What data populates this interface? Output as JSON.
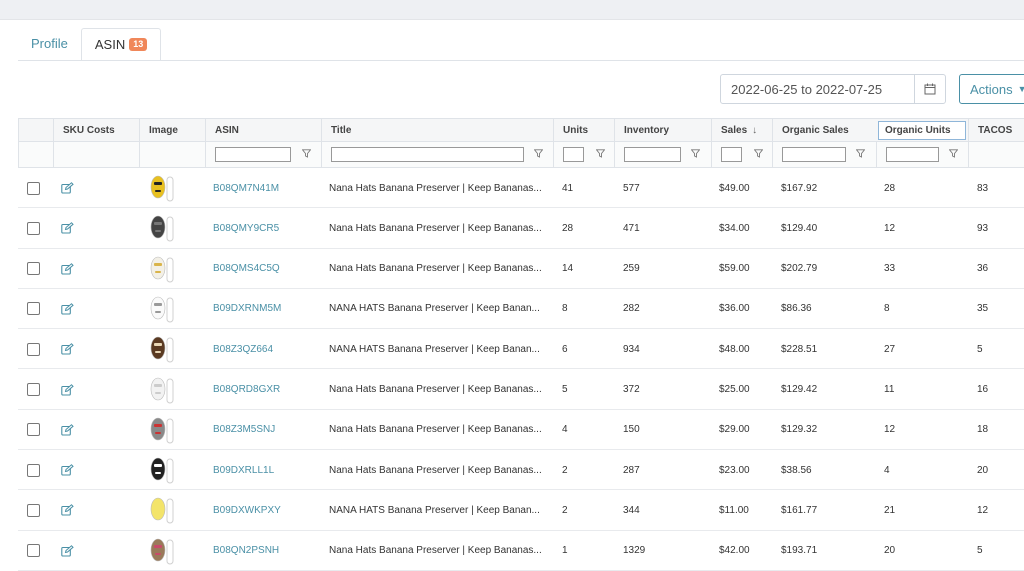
{
  "tabs": [
    {
      "label": "Profile",
      "active": false
    },
    {
      "label": "ASIN",
      "active": true,
      "badge": "13"
    }
  ],
  "date_range": {
    "value": "2022-06-25 to 2022-07-25"
  },
  "actions": {
    "label": "Actions"
  },
  "columns": {
    "sku_costs": "SKU Costs",
    "image": "Image",
    "asin": "ASIN",
    "title": "Title",
    "units": "Units",
    "inventory": "Inventory",
    "sales": "Sales",
    "organic_sales": "Organic Sales",
    "organic_units": "Organic Units",
    "tacos": "TACOS"
  },
  "sort_indicator": "↓",
  "colors": {
    "link": "#4a90a6",
    "badge": "#f0875a",
    "header_bg": "#f5f6f7",
    "border": "#dfe3e8"
  },
  "rows": [
    {
      "asin": "B08QM7N41M",
      "title": "Nana Hats Banana Preserver | Keep Bananas...",
      "units": "41",
      "inventory": "577",
      "sales": "$49.00",
      "organic_sales": "$167.92",
      "organic_units": "28",
      "tacos": "83",
      "hat_color": "#e8c020",
      "hat_accent": "#222"
    },
    {
      "asin": "B08QMY9CR5",
      "title": "Nana Hats Banana Preserver | Keep Bananas...",
      "units": "28",
      "inventory": "471",
      "sales": "$34.00",
      "organic_sales": "$129.40",
      "organic_units": "12",
      "tacos": "93",
      "hat_color": "#444",
      "hat_accent": "#777"
    },
    {
      "asin": "B08QMS4C5Q",
      "title": "Nana Hats Banana Preserver | Keep Bananas...",
      "units": "14",
      "inventory": "259",
      "sales": "$59.00",
      "organic_sales": "$202.79",
      "organic_units": "33",
      "tacos": "36",
      "hat_color": "#f3f0e6",
      "hat_accent": "#d9b44a"
    },
    {
      "asin": "B09DXRNM5M",
      "title": "NANA HATS Banana Preserver | Keep Banan...",
      "units": "8",
      "inventory": "282",
      "sales": "$36.00",
      "organic_sales": "$86.36",
      "organic_units": "8",
      "tacos": "35",
      "hat_color": "#fafafa",
      "hat_accent": "#999"
    },
    {
      "asin": "B08Z3QZ664",
      "title": "NANA HATS Banana Preserver | Keep Banan...",
      "units": "6",
      "inventory": "934",
      "sales": "$48.00",
      "organic_sales": "$228.51",
      "organic_units": "27",
      "tacos": "5",
      "hat_color": "#5a3a22",
      "hat_accent": "#e9d7b6"
    },
    {
      "asin": "B08QRD8GXR",
      "title": "Nana Hats Banana Preserver | Keep Bananas...",
      "units": "5",
      "inventory": "372",
      "sales": "$25.00",
      "organic_sales": "$129.42",
      "organic_units": "11",
      "tacos": "16",
      "hat_color": "#f2f2f2",
      "hat_accent": "#ccc"
    },
    {
      "asin": "B08Z3M5SNJ",
      "title": "Nana Hats Banana Preserver | Keep Bananas...",
      "units": "4",
      "inventory": "150",
      "sales": "$29.00",
      "organic_sales": "$129.32",
      "organic_units": "12",
      "tacos": "18",
      "hat_color": "#8a8a8a",
      "hat_accent": "#c33"
    },
    {
      "asin": "B09DXRLL1L",
      "title": "Nana Hats Banana Preserver | Keep Bananas...",
      "units": "2",
      "inventory": "287",
      "sales": "$23.00",
      "organic_sales": "$38.56",
      "organic_units": "4",
      "tacos": "20",
      "hat_color": "#222",
      "hat_accent": "#fff"
    },
    {
      "asin": "B09DXWKPXY",
      "title": "NANA HATS Banana Preserver | Keep Banan...",
      "units": "2",
      "inventory": "344",
      "sales": "$11.00",
      "organic_sales": "$161.77",
      "organic_units": "21",
      "tacos": "12",
      "hat_color": "#f3e46a",
      "hat_accent": "#f3e46a"
    },
    {
      "asin": "B08QN2PSNH",
      "title": "Nana Hats Banana Preserver | Keep Bananas...",
      "units": "1",
      "inventory": "1329",
      "sales": "$42.00",
      "organic_sales": "$193.71",
      "organic_units": "20",
      "tacos": "5",
      "hat_color": "#9a7a5a",
      "hat_accent": "#c94a6a"
    }
  ]
}
